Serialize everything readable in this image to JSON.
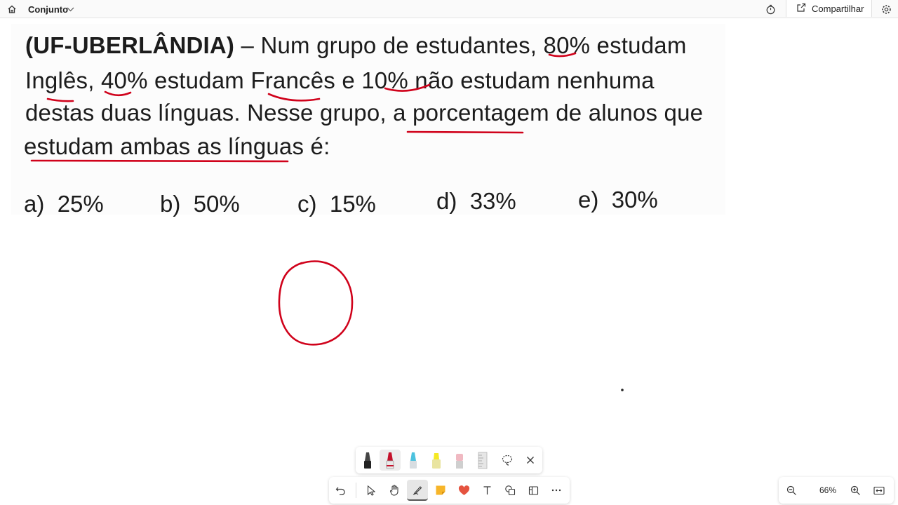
{
  "header": {
    "title": "Conjunto",
    "share_label": "Compartilhar",
    "icons": [
      "home-icon",
      "chevron-down-icon",
      "timer-icon",
      "share-icon",
      "settings-icon"
    ]
  },
  "problem": {
    "source": "(UF-UBERLÂNDIA)",
    "dash": "–",
    "line1_rest": "Num grupo de estudantes, 80% estudam",
    "line2": "Inglês, 40% estudam Francês e 10% não estudam nenhuma",
    "line3": "destas duas línguas. Nesse grupo, a porcentagem de alunos que",
    "line4": "estudam ambas as línguas é:",
    "options": [
      {
        "letter": "a)",
        "value": "25%"
      },
      {
        "letter": "b)",
        "value": "50%"
      },
      {
        "letter": "c)",
        "value": "15%"
      },
      {
        "letter": "d)",
        "value": "33%"
      },
      {
        "letter": "e)",
        "value": "30%"
      }
    ]
  },
  "ink": {
    "color": "#d0021b"
  },
  "pen_palette": {
    "pens": [
      "black-pen-icon",
      "red-pen-icon",
      "blue-pen-icon",
      "yellow-highlighter-icon",
      "eraser-icon",
      "ruler-icon",
      "lasso-icon",
      "close-icon"
    ],
    "selected": "red-pen-icon"
  },
  "toolbar": {
    "tools": [
      "undo-icon",
      "select-icon",
      "hand-icon",
      "pen-tool-icon",
      "sticky-note-icon",
      "heart-reaction-icon",
      "text-icon",
      "shapes-icon",
      "template-icon",
      "more-icon"
    ],
    "selected": "pen-tool-icon"
  },
  "zoom": {
    "level": "66%"
  }
}
